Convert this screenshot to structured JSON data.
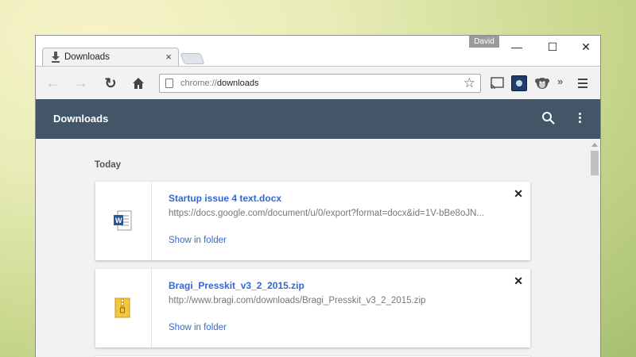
{
  "window": {
    "profile_name": "David",
    "tab_title": "Downloads",
    "minimize": "—",
    "maximize": "☐",
    "close": "✕"
  },
  "toolbar": {
    "url_scheme": "chrome://",
    "url_host": "downloads",
    "overflow": "»"
  },
  "page": {
    "title": "Downloads",
    "section": "Today",
    "items": [
      {
        "name": "Startup issue 4 text.docx",
        "url": "https://docs.google.com/document/u/0/export?format=docx&id=1V-bBe8oJN...",
        "action": "Show in folder",
        "icon": "word-doc-icon"
      },
      {
        "name": "Bragi_Presskit_v3_2_2015.zip",
        "url": "http://www.bragi.com/downloads/Bragi_Presskit_v3_2_2015.zip",
        "action": "Show in folder",
        "icon": "zip-file-icon"
      }
    ]
  },
  "colors": {
    "header": "#425668",
    "link": "#3367d6"
  }
}
